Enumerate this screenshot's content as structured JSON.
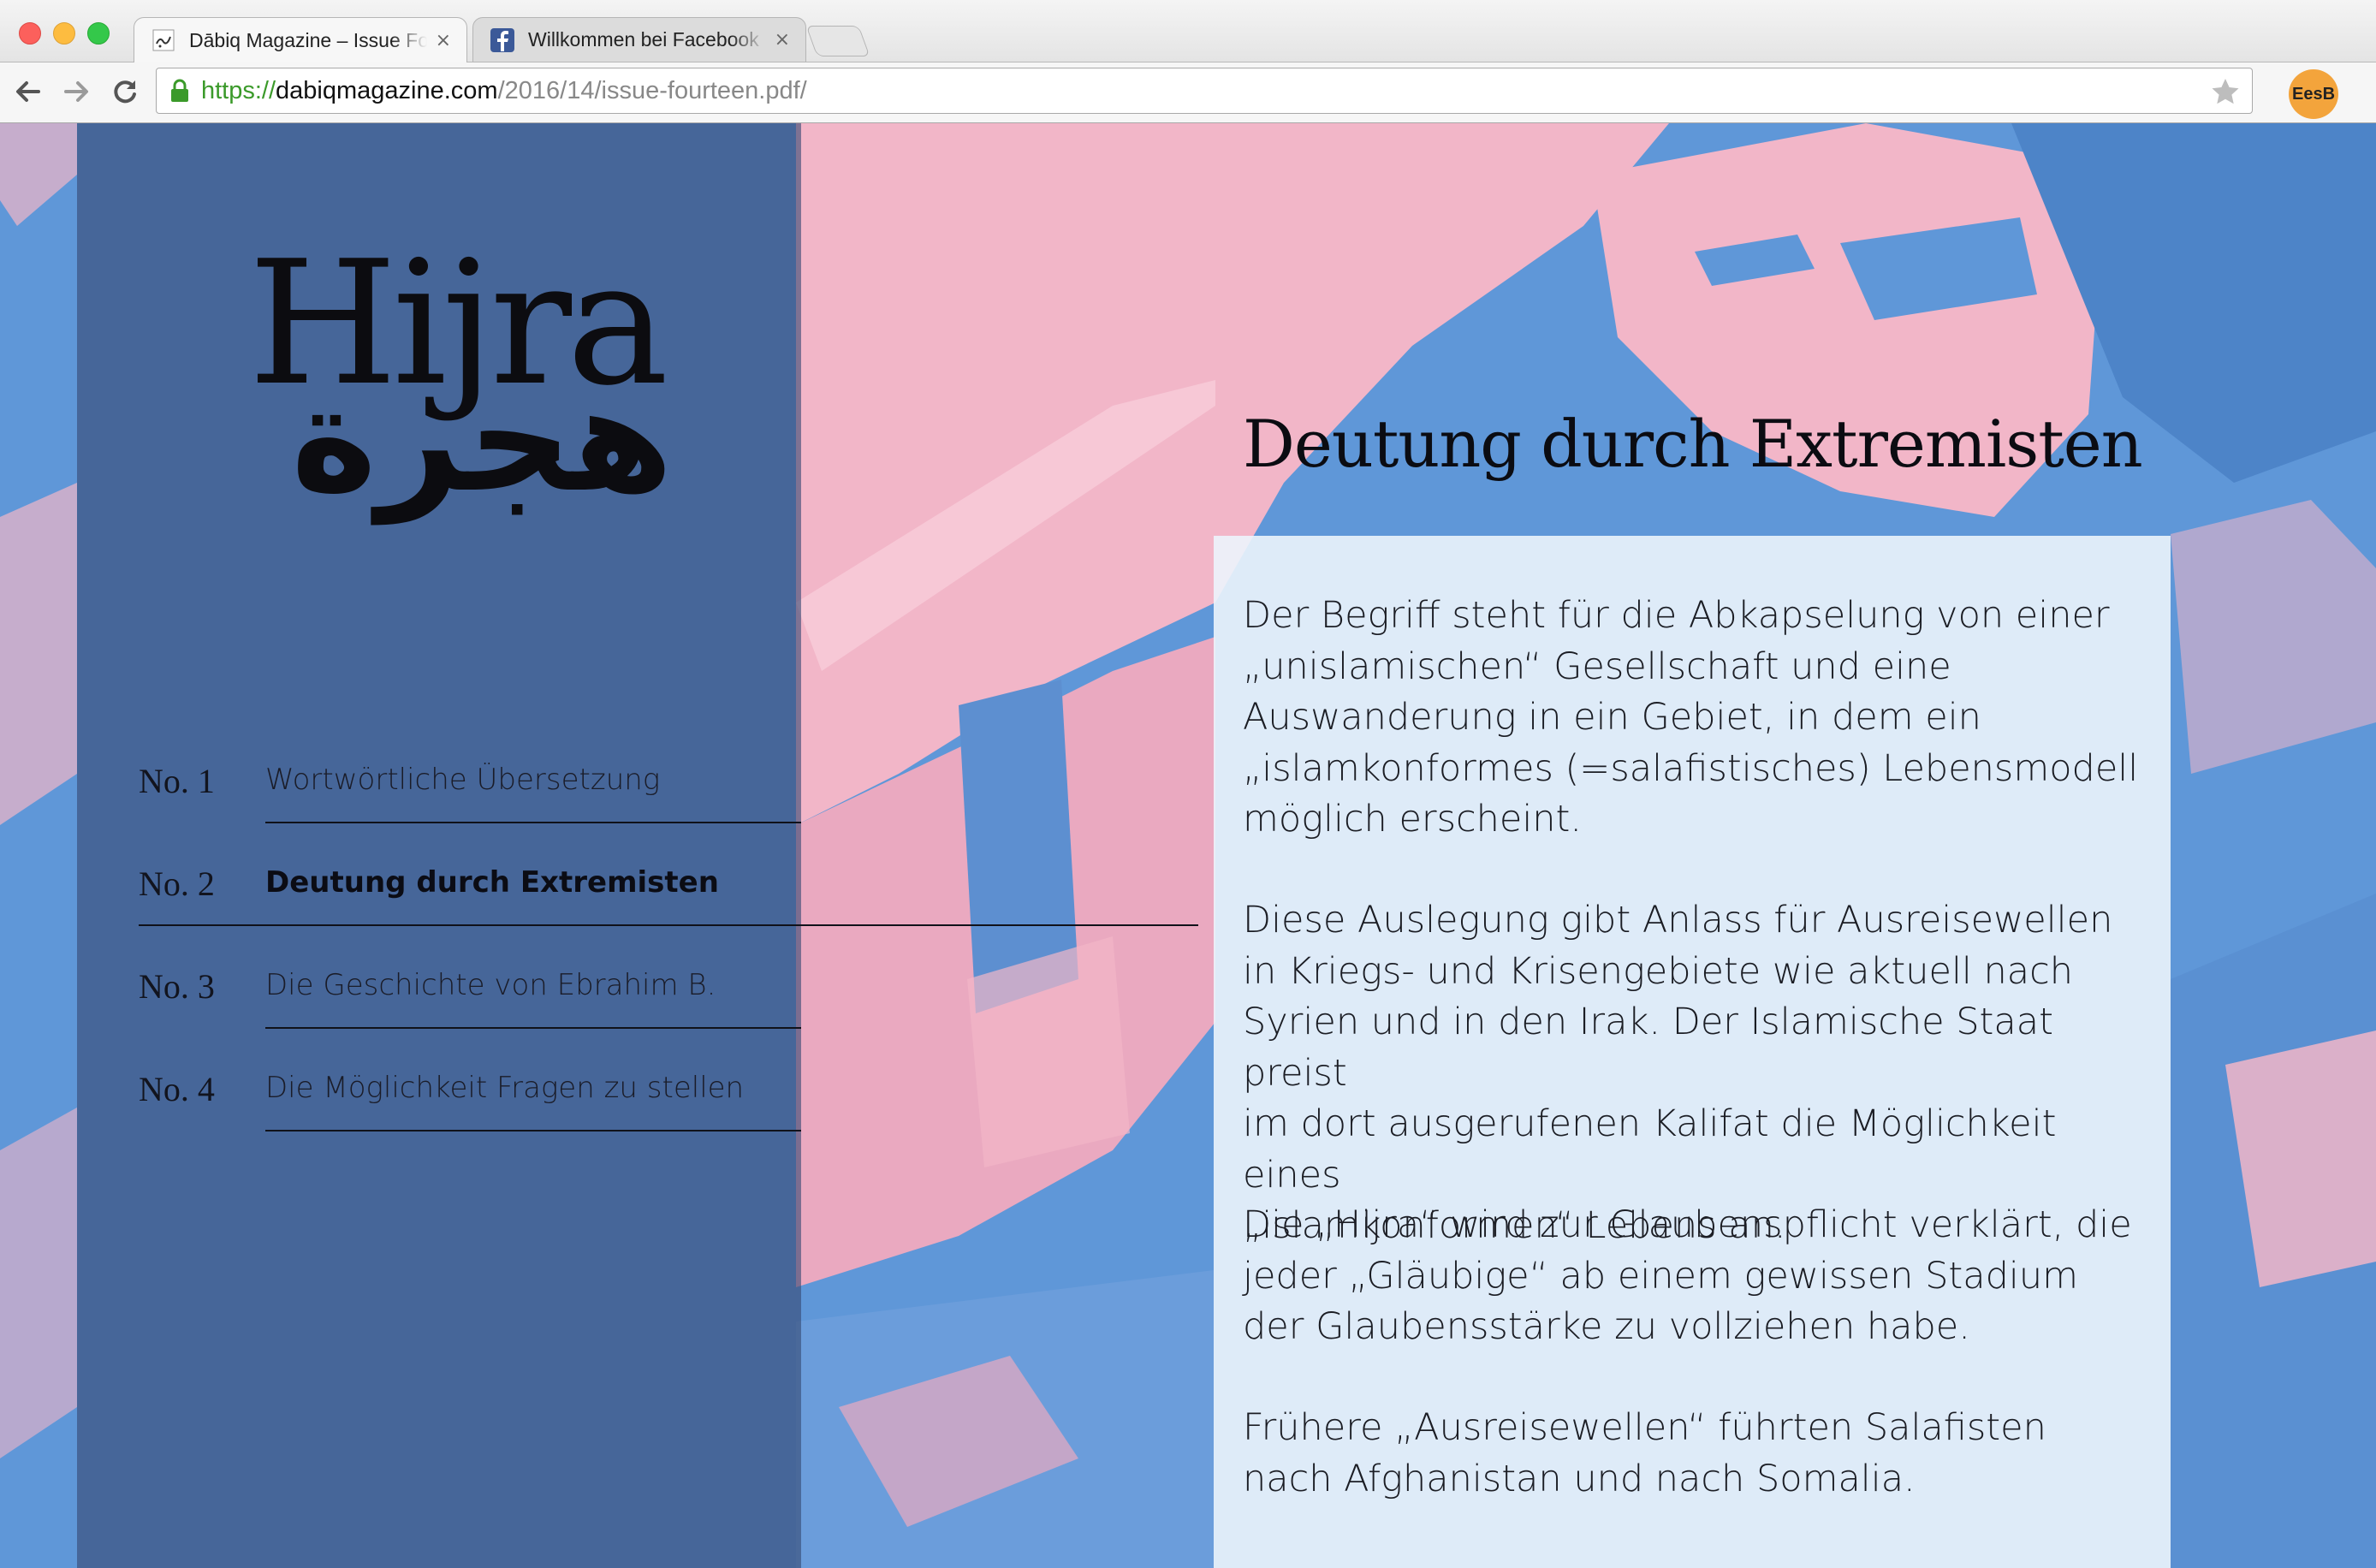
{
  "browser": {
    "tabs": [
      {
        "title": "Dābiq Magazine – Issue Fourteen",
        "favicon": "dabiq-favicon",
        "close": "×",
        "active": true
      },
      {
        "title": "Willkommen bei Facebook",
        "favicon": "facebook-icon",
        "close": "×",
        "active": false
      }
    ],
    "url": {
      "scheme": "https://",
      "host": "dabiqmagazine.com",
      "path": "/2016/14/issue-fourteen.pdf/"
    },
    "profile": "EesB"
  },
  "page": {
    "logo": {
      "latin": "Hijra",
      "arabic": "هجرة"
    },
    "nav": [
      {
        "no": "No. 1",
        "label": "Wortwörtliche Übersetzung",
        "active": false
      },
      {
        "no": "No. 2",
        "label": "Deutung durch Extremisten",
        "active": true
      },
      {
        "no": "No. 3",
        "label": "Die Geschichte von Ebrahim B.",
        "active": false
      },
      {
        "no": "No. 4",
        "label": "Die Möglichkeit Fragen zu stellen",
        "active": false
      }
    ],
    "heading": "Deutung durch Extremisten",
    "paragraphs": [
      [
        "Der Begriff steht für die Abkapselung von einer",
        "„unislamischen“ Gesellschaft und eine",
        "Auswanderung in ein Gebiet, in dem ein",
        "„islamkonformes (=salafistisches) Lebensmodell",
        "möglich erscheint."
      ],
      [
        "Diese Auslegung gibt Anlass für Ausreisewellen",
        "in Kriegs- und Krisengebiete wie aktuell nach",
        "Syrien und in den Irak. Der Islamische Staat preist",
        "im dort ausgerufenen Kalifat die Möglichkeit eines",
        "„islamkonformen“ Lebens an."
      ],
      [
        "Die „Hijra“ wird zur Glaubenspflicht verklärt, die",
        "jeder „Gläubige“ ab einem gewissen Stadium",
        "der Glaubensstärke zu vollziehen habe."
      ],
      [
        "Frühere „Ausreisewellen“ führten Salafisten",
        "nach Afghanistan und nach Somalia."
      ]
    ]
  },
  "colors": {
    "duotone_blue": "#5f97d8",
    "duotone_pink": "#f2b6c8",
    "sidebar": "#374873",
    "text": "#1b1d24"
  }
}
